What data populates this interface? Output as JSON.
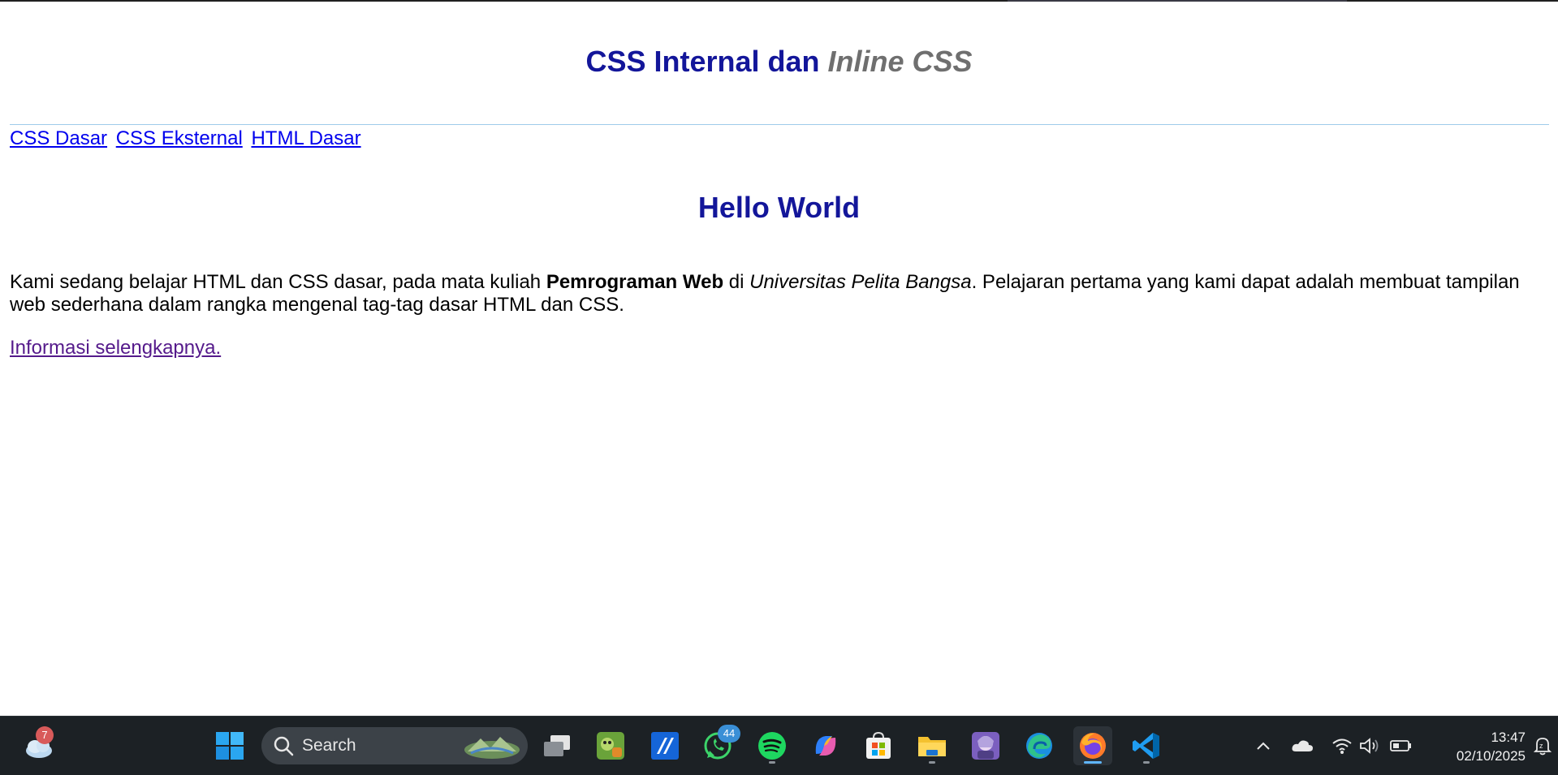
{
  "page": {
    "title_main": "CSS Internal dan ",
    "title_inline": "Inline CSS",
    "nav_links": [
      "CSS Dasar",
      "CSS Eksternal",
      "HTML Dasar"
    ],
    "heading": "Hello World",
    "paragraph": {
      "part1": "Kami sedang belajar HTML dan CSS dasar, pada mata kuliah ",
      "bold": "Pemrograman Web",
      "part2": " di ",
      "italic": "Universitas Pelita Bangsa",
      "part3": ". Pelajaran pertama yang kami dapat adalah membuat tampilan web sederhana dalam rangka mengenal tag-tag dasar HTML dan CSS."
    },
    "more_link": "Informasi selengkapnya."
  },
  "taskbar": {
    "weather_badge": "7",
    "search_label": "Search",
    "whatsapp_badge": "44",
    "time": "13:47",
    "date": "02/10/2025",
    "icons": [
      "weather-icon",
      "start-icon",
      "search-icon",
      "task-view-icon",
      "plants-vs-zombies-icon",
      "app-icon",
      "whatsapp-icon",
      "spotify-icon",
      "copilot-icon",
      "microsoft-store-icon",
      "file-explorer-icon",
      "game-app-icon",
      "edge-icon",
      "firefox-icon",
      "vscode-icon",
      "chevron-up-icon",
      "onedrive-icon",
      "wifi-icon",
      "volume-icon",
      "battery-icon",
      "notification-icon"
    ]
  },
  "colors": {
    "heading": "#13169a",
    "inline_title": "#6f6f6f",
    "link": "#0000ee",
    "visited_link": "#551a8b",
    "taskbar": "#1c2125"
  }
}
